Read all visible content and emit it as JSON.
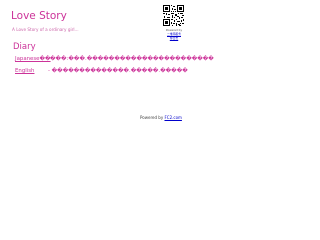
{
  "header": {
    "title": "Love Story",
    "subtitle": "A Love Story of a ordinary girl..."
  },
  "qr": {
    "icon": "qr-code-icon",
    "caption": "Powered by",
    "link_line1": "二维码服务",
    "link_line2": "博日志"
  },
  "diary": {
    "heading": "Diary",
    "entries": [
      {
        "link": "Japanese��",
        "text": "���:���.�����������������������"
      },
      {
        "link": "English",
        "text": "- ��������������.�����.�����"
      }
    ]
  },
  "footer": {
    "prefix": "Powered by",
    "link": "FC2.com"
  },
  "colors": {
    "accent": "#cc3399",
    "link": "#0000cc",
    "background": "#ffffff"
  }
}
